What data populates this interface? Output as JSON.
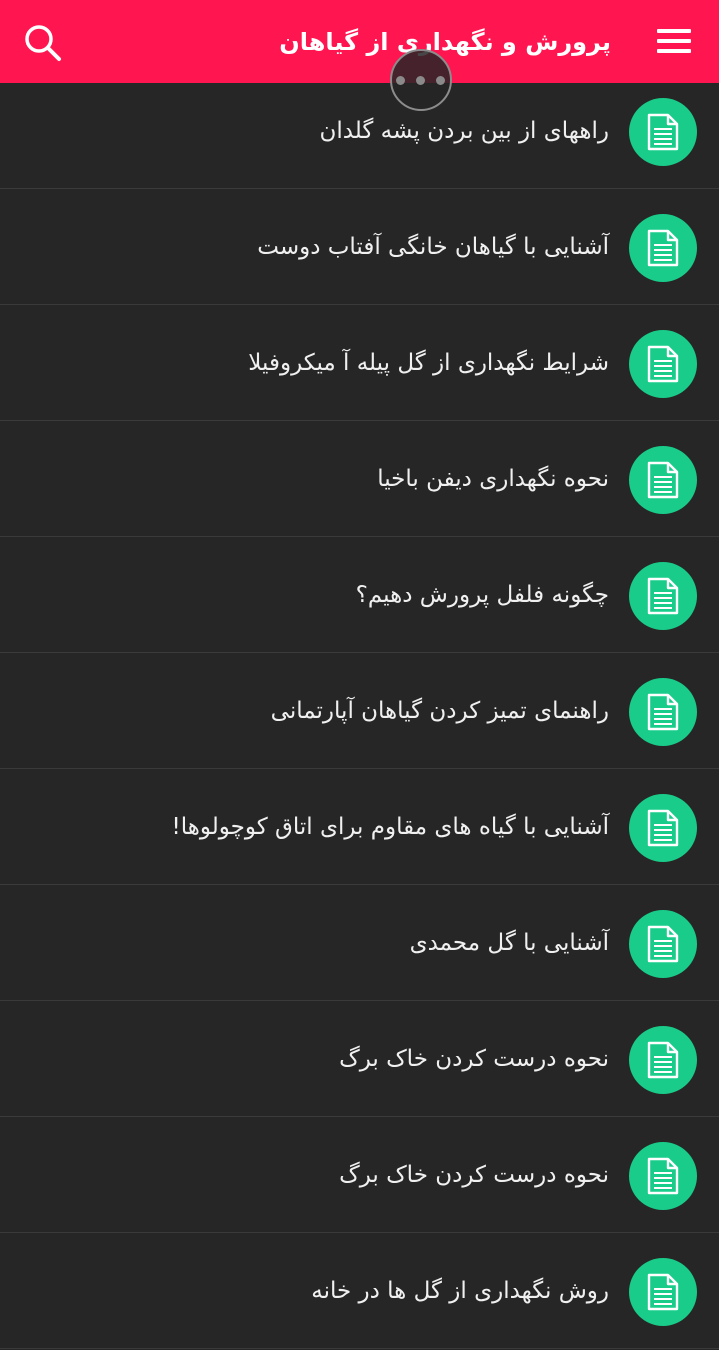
{
  "app": {
    "title": "پرورش و نگهداری از گیاهان",
    "accent_color": "#ff1650",
    "icon_color": "#19cc8a",
    "menu_icon": "hamburger-menu-icon",
    "search_icon": "search-icon",
    "item_icon": "document-icon"
  },
  "list": {
    "items": [
      "راههای از بین بردن پشه گلدان",
      "آشنایی با گیاهان خانگی آفتاب دوست",
      "شرایط نگهداری از گل پیله آ میکروفیلا",
      "نحوه نگهداری دیفن باخیا",
      "چگونه فلفل پرورش دهیم؟",
      "راهنمای تمیز کردن گیاهان آپارتمانی",
      "آشنایی با گیاه های مقاوم برای اتاق کوچولوها!",
      "آشنایی با گل محمدی",
      "نحوه درست کردن خاک برگ",
      "نحوه درست کردن خاک برگ",
      "روش نگهداری از گل ها در خانه"
    ]
  }
}
